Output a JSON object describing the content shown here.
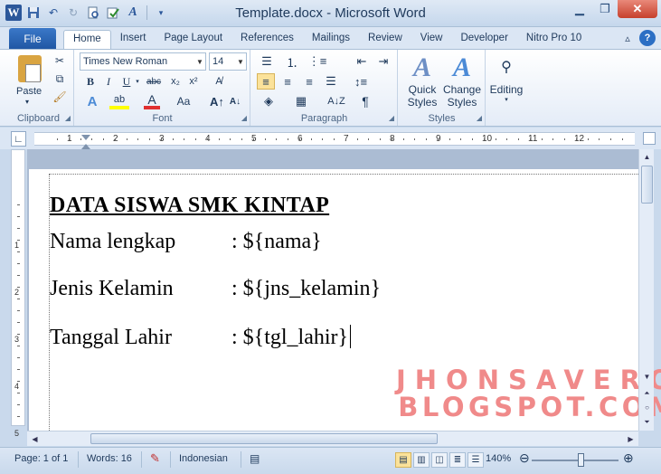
{
  "window": {
    "title": "Template.docx - Microsoft Word",
    "app_icon_letter": "W",
    "qat_icons": [
      "save-icon",
      "undo-icon",
      "redo-icon",
      "print-preview-icon",
      "spelling-icon",
      "font-color-icon",
      "customize-qat-icon"
    ]
  },
  "tabs": {
    "file": "File",
    "items": [
      "Home",
      "Insert",
      "Page Layout",
      "References",
      "Mailings",
      "Review",
      "View",
      "Developer",
      "Nitro Pro 10"
    ],
    "active": "Home"
  },
  "ribbon": {
    "clipboard": {
      "label": "Clipboard",
      "paste": "Paste"
    },
    "font": {
      "label": "Font",
      "family": "Times New Roman",
      "size": "14"
    },
    "paragraph": {
      "label": "Paragraph"
    },
    "styles": {
      "label": "Styles",
      "quick_styles_1": "Quick",
      "quick_styles_2": "Styles",
      "change_styles_1": "Change",
      "change_styles_2": "Styles"
    },
    "editing": {
      "label": "Editing"
    }
  },
  "ruler": {
    "numbers": [
      "1",
      "2",
      "3",
      "4",
      "5",
      "6",
      "7",
      "8",
      "9",
      "10",
      "11",
      "12"
    ],
    "vertical_numbers": [
      "1",
      "2",
      "3",
      "4",
      "5"
    ]
  },
  "document": {
    "heading": "DATA SISWA SMK KINTAP",
    "rows": [
      {
        "label": "Nama lengkap",
        "value": ": ${nama}"
      },
      {
        "label": "Jenis Kelamin",
        "value": ": ${jns_kelamin}"
      },
      {
        "label": "Tanggal Lahir",
        "value": ": ${tgl_lahir}"
      }
    ]
  },
  "watermark": {
    "line1": "JHONSAVERO",
    "line2": "BLOGSPOT.COM"
  },
  "status": {
    "page": "Page: 1 of 1",
    "words": "Words: 16",
    "language": "Indonesian",
    "zoom": "140%",
    "zoom_level": 140
  }
}
